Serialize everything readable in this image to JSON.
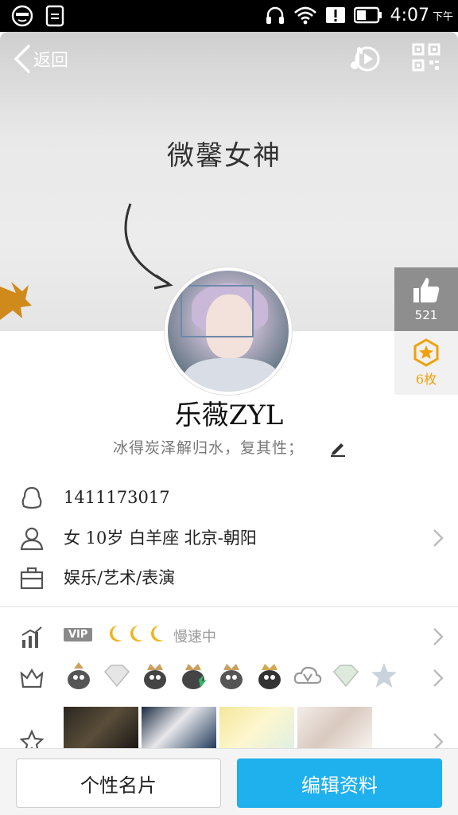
{
  "status_bar": {
    "time": "4:07",
    "ampm": "下午"
  },
  "header": {
    "back_label": "返回"
  },
  "cover": {
    "title": "微馨女神"
  },
  "likes": {
    "count": "521"
  },
  "medals": {
    "count": "6枚"
  },
  "profile": {
    "nickname": "乐薇ZYL",
    "signature": "冰得炭泽解归水，复其性；"
  },
  "info": {
    "qq_number": "1411173017",
    "personal": "女  10岁  白羊座  北京-朝阳",
    "occupation": "娱乐/艺术/表演"
  },
  "level": {
    "vip_label": "VIP",
    "speed_text": "慢速中"
  },
  "buttons": {
    "card": "个性名片",
    "edit": "编辑资料"
  },
  "colors": {
    "accent": "#1fb0ee",
    "medal": "#f0a10a",
    "like_bg": "#8e8e8e"
  }
}
